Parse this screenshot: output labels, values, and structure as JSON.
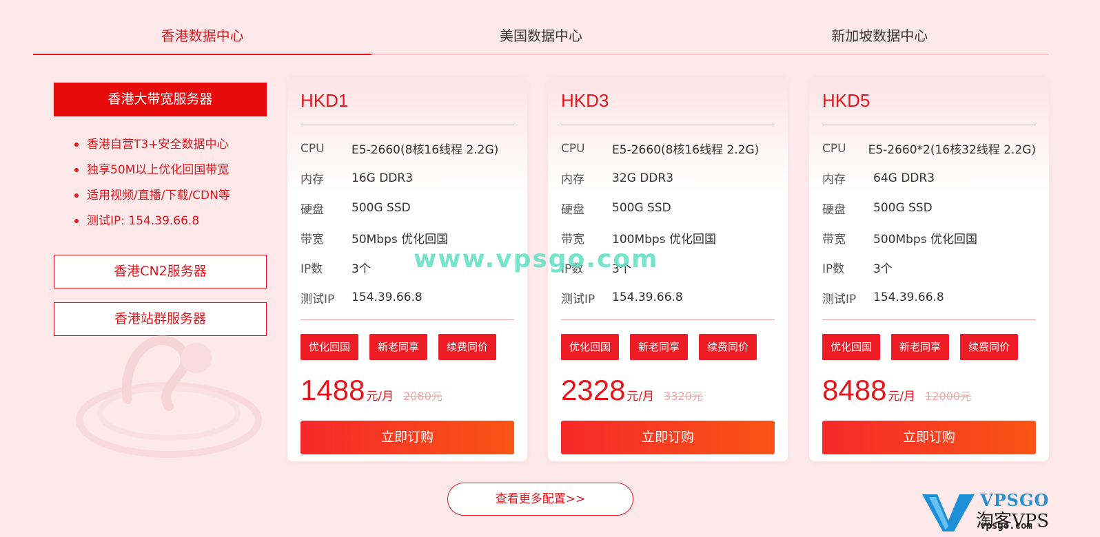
{
  "tabs": [
    {
      "label": "香港数据中心",
      "active": true
    },
    {
      "label": "美国数据中心",
      "active": false
    },
    {
      "label": "新加坡数据中心",
      "active": false
    }
  ],
  "sidebar": {
    "primary_label": "香港大带宽服务器",
    "features": [
      "香港自营T3+安全数据中心",
      "独享50M以上优化回国带宽",
      "适用视频/直播/下载/CDN等",
      "测试IP: 154.39.66.8"
    ],
    "cn2_label": "香港CN2服务器",
    "station_label": "香港站群服务器"
  },
  "spec_labels": {
    "cpu": "CPU",
    "memory": "内存",
    "disk": "硬盘",
    "bandwidth": "带宽",
    "ip_count": "IP数",
    "test_ip": "测试IP"
  },
  "tags": [
    "优化回国",
    "新老同享",
    "续费同价"
  ],
  "price_unit": "元/月",
  "buy_label": "立即订购",
  "cards": [
    {
      "title": "HKD1",
      "cpu": "E5-2660(8核16线程 2.2G)",
      "memory": "16G DDR3",
      "disk": "500G SSD",
      "bandwidth": "50Mbps 优化回国",
      "ip_count": "3个",
      "test_ip": "154.39.66.8",
      "price": "1488",
      "old_price": "2080元"
    },
    {
      "title": "HKD3",
      "cpu": "E5-2660(8核16线程 2.2G)",
      "memory": "32G DDR3",
      "disk": "500G SSD",
      "bandwidth": "100Mbps 优化回国",
      "ip_count": "3个",
      "test_ip": "154.39.66.8",
      "price": "2328",
      "old_price": "3320元"
    },
    {
      "title": "HKD5",
      "cpu": "E5-2660*2(16核32线程 2.2G)",
      "memory": "64G DDR3",
      "disk": "500G SSD",
      "bandwidth": "500Mbps 优化回国",
      "ip_count": "3个",
      "test_ip": "154.39.66.8",
      "price": "8488",
      "old_price": "12000元"
    }
  ],
  "more_label": "查看更多配置>>",
  "watermark": {
    "center": "www.vpsgo.com",
    "logo_line1": "VPSGO",
    "logo_line2": "淘客VPS",
    "logo_line3": "vpsgo.com"
  },
  "colors": {
    "accent": "#e8141b",
    "background": "#fde9ea",
    "buy_gradient_start": "#f6282a",
    "buy_gradient_end": "#fa5515"
  }
}
